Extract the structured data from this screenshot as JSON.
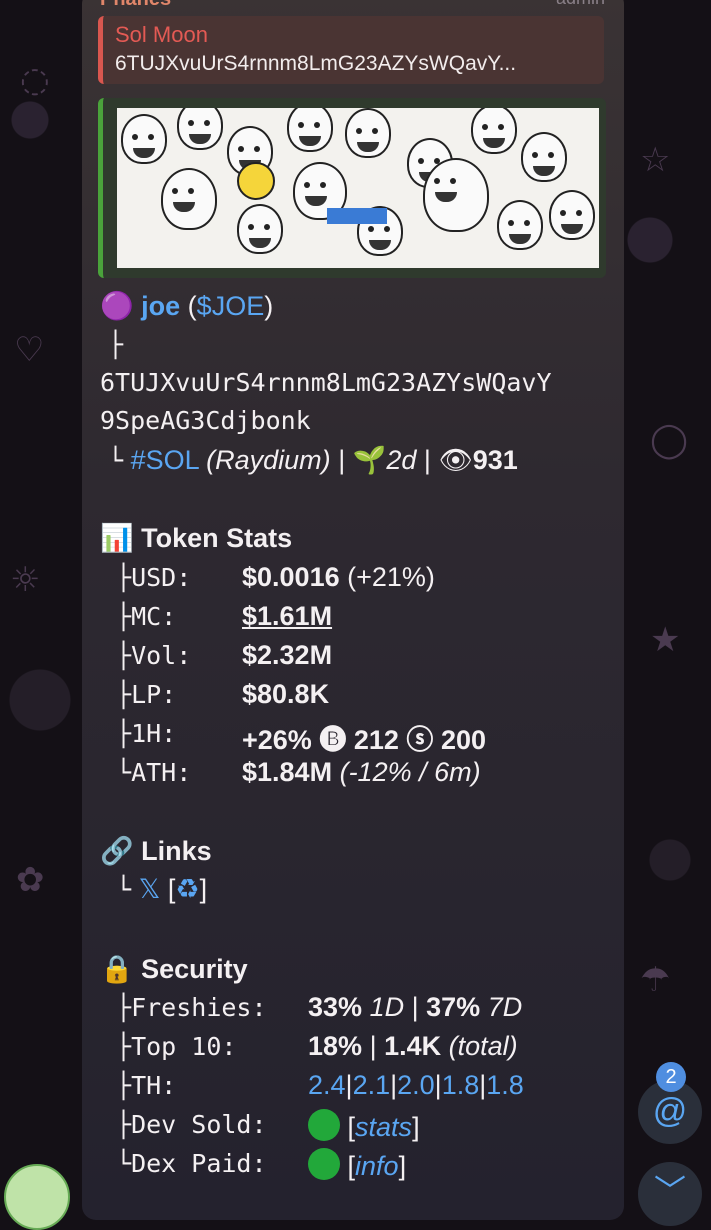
{
  "header": {
    "sender": "Phanes",
    "role": "admin"
  },
  "reply": {
    "title": "Sol Moon",
    "text": "6TUJXvuUrS4rnnm8LmG23AZYsWQavY..."
  },
  "token": {
    "dot": "🟣",
    "name": "joe",
    "ticker": "$JOE",
    "tree_top": "├",
    "address_line1": "6TUJXvuUrS4rnnm8LmG23AZYsWQavY",
    "address_line2": "9SpeAG3Cdjbonk",
    "chain_prefix": "└",
    "chain": "#SOL",
    "dex": "(Raydium)",
    "sep1": "|",
    "age_icon": "🌱",
    "age": "2d",
    "sep2": "|",
    "views_icon": "👁",
    "views": "931"
  },
  "token_stats": {
    "icon": "📊",
    "title": "Token Stats",
    "rows": [
      {
        "prefix": "├",
        "label": "USD:",
        "value": "$0.0016",
        "extra": "(+21%)"
      },
      {
        "prefix": "├",
        "label": "MC:",
        "value": "$1.61M"
      },
      {
        "prefix": "├",
        "label": "Vol:",
        "value": "$2.32M"
      },
      {
        "prefix": "├",
        "label": "LP:",
        "value": "$80.8K"
      },
      {
        "prefix": "├",
        "label": "1H:",
        "value": "+26%",
        "b_icon": "🅑",
        "b": "212",
        "s_icon": "ⓢ",
        "s": "200"
      },
      {
        "prefix": "└",
        "label": "ATH:",
        "value": "$1.84M",
        "extra": "(-12% / 6m)"
      }
    ]
  },
  "links": {
    "icon": "🔗",
    "title": "Links",
    "prefix": "└",
    "x": "𝕏",
    "bracket_open": "[",
    "recycle": "♻",
    "bracket_close": "]"
  },
  "security": {
    "icon": "🔒",
    "title": "Security",
    "freshies": {
      "prefix": "├",
      "label": "Freshies:",
      "v1": "33%",
      "p1": "1D",
      "sep": "|",
      "v2": "37%",
      "p2": "7D"
    },
    "top10": {
      "prefix": "├",
      "label": "Top 10:",
      "v1": "18%",
      "sep": "|",
      "v2": "1.4K",
      "note": "(total)"
    },
    "th": {
      "prefix": "├",
      "label": "TH:",
      "values": [
        "2.4",
        "2.1",
        "2.0",
        "1.8",
        "1.8"
      ],
      "sep": "|"
    },
    "dev_sold": {
      "prefix": "├",
      "label": "Dev Sold:",
      "link": "stats",
      "open": "[",
      "close": "]"
    },
    "dex_paid": {
      "prefix": "└",
      "label": "Dex Paid:",
      "link": "info",
      "open": "[",
      "close": "]"
    }
  },
  "overlay": {
    "mentions_count": "2",
    "mention_icon": "@",
    "scroll_down_icon": "﹀"
  },
  "colors": {
    "link": "#5aa6f2",
    "reply_accent": "#d9574f",
    "preview_accent": "#4aa33b",
    "green_dot": "#22a83a"
  }
}
